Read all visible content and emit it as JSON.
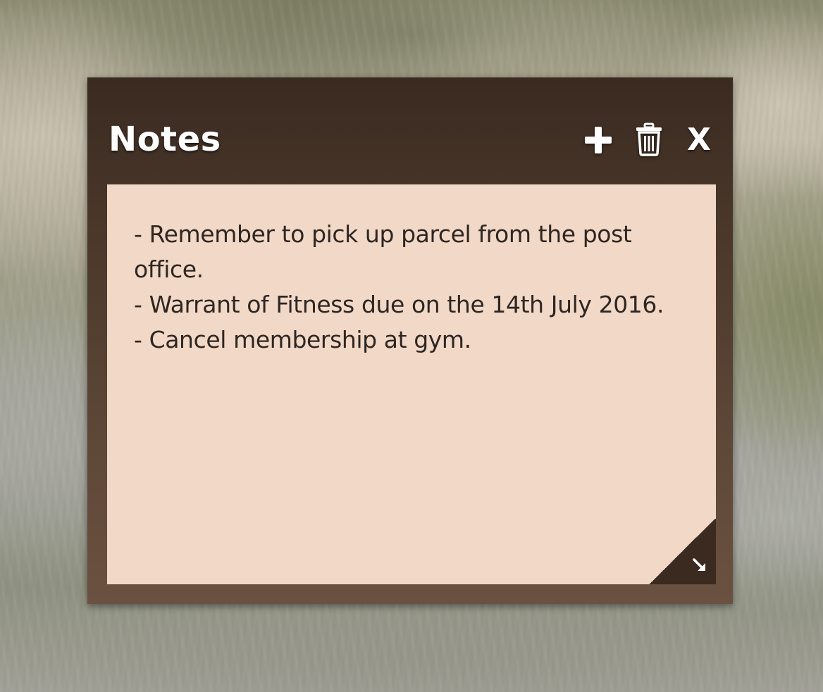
{
  "widget": {
    "title": "Notes",
    "toolbar": {
      "add_icon": "plus-icon",
      "delete_icon": "trash-icon",
      "close_label": "X"
    },
    "note": {
      "lines": [
        "- Remember to pick up parcel from the post office.",
        "- Warrant of Fitness due on the 14th July 2016.",
        "- Cancel membership at gym."
      ]
    },
    "resize_icon": "resize-arrow-icon"
  },
  "colors": {
    "frame_top": "#3a2a20",
    "frame_bottom": "#6b5140",
    "paper": "#f2d8c7",
    "text": "#2e2622",
    "icon": "#ffffff"
  }
}
